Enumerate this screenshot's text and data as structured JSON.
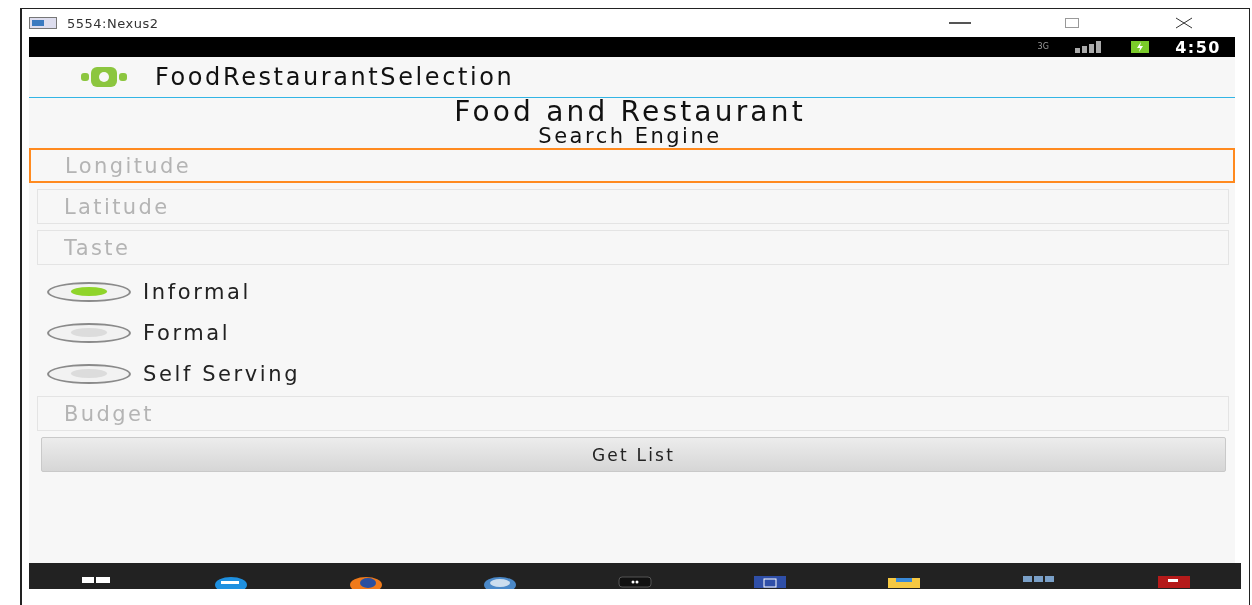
{
  "window": {
    "title": "5554:Nexus2"
  },
  "status_bar": {
    "network": "3G",
    "time": "4:50"
  },
  "app_bar": {
    "title": "FoodRestaurantSelection"
  },
  "heading": {
    "line_1": "Food and Restaurant",
    "line_2": "Search Engine"
  },
  "fields": [
    {
      "placeholder": "Longitude",
      "focused": true
    },
    {
      "placeholder": "Latitude",
      "focused": false
    },
    {
      "placeholder": "Taste",
      "focused": false
    }
  ],
  "radios": [
    {
      "label": "Informal",
      "selected": true
    },
    {
      "label": "Formal",
      "selected": false
    },
    {
      "label": "Self Serving",
      "selected": false
    }
  ],
  "budget": {
    "placeholder": "Budget",
    "focused": false
  },
  "button": {
    "label": "Get List"
  }
}
